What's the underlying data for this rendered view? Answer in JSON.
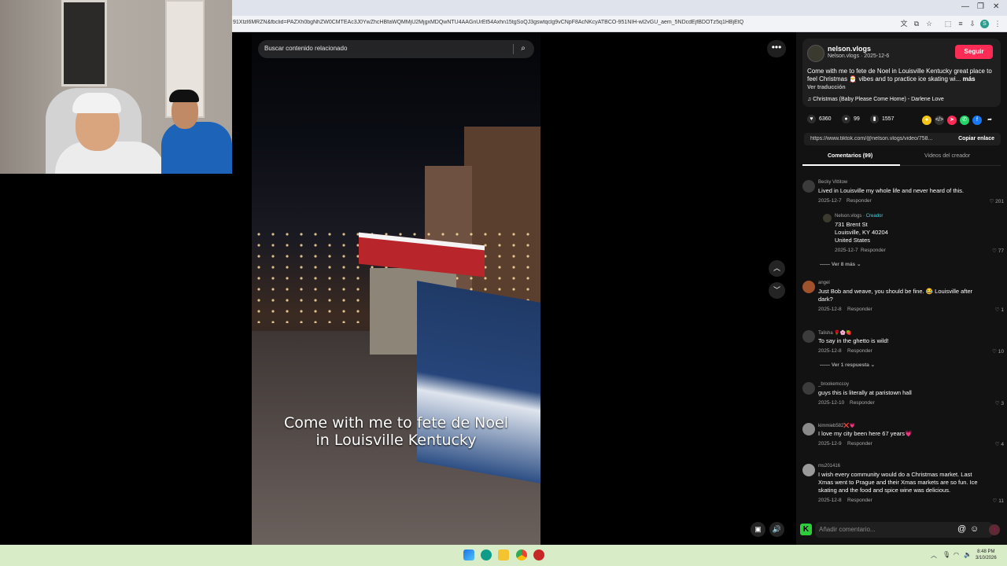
{
  "browser": {
    "url": "91Xtzl6MRZN&fbclid=PAZXh0bgNhZW0CMTEAc3J0YwZhcHBfaWQMMjU2MjgxMDQwNTU4AAGnUrEt54Axhn15tgSoQJ3gswtqclg9vCNpF8AcNKcyATBCO-951NIH-wl2vGU_aem_5NDcdEjfBDOTz5q1HBjEtQ",
    "profile_initial": "S"
  },
  "video": {
    "search_placeholder": "Buscar contenido relacionado",
    "caption_line1": "Come with me to fete de Noel",
    "caption_line2": "in Louisville Kentucky"
  },
  "post": {
    "author_name": "nelson.vlogs",
    "author_meta": "Nelson.vlogs · 2025-12-6",
    "follow_label": "Seguir",
    "description": "Come with me to fete de Noel in Louisville Kentucky great place to feel Christmas 🎅 vibes and to practice ice skating wi...",
    "more_label": "más",
    "translate_label": "Ver traducción",
    "music": "Christmas (Baby Please Come Home) - Darlene Love",
    "likes": "6360",
    "comments": "99",
    "saves": "1557",
    "link": "https://www.tiktok.com/@nelson.vlogs/video/758...",
    "copy_label": "Copiar enlace"
  },
  "tabs": {
    "comments": "Comentarios (99)",
    "creator_videos": "Videos del creador"
  },
  "comments": [
    {
      "user": "Becky Vittitow",
      "text": "Lived in Louisville my whole life and never heard of this.",
      "date": "2025-12-7",
      "reply": "Responder",
      "likes": "201"
    },
    {
      "user": "angel",
      "text": "Just Bob and weave, you should be fine. 😂 Louisville after dark?",
      "date": "2025-12-8",
      "reply": "Responder",
      "likes": "1"
    },
    {
      "user": "Talisha 🌹🌸🍓",
      "text": "To say in the ghetto is wild!",
      "date": "2025-12-8",
      "reply": "Responder",
      "likes": "10"
    },
    {
      "user": "_brookemccoy",
      "text": "guys this is literally at paristown hall",
      "date": "2025-12-10",
      "reply": "Responder",
      "likes": "3"
    },
    {
      "user": "kimmieb582❌💗",
      "text": "I love my city been here 67 years💗",
      "date": "2025-12-9",
      "reply": "Responder",
      "likes": "4"
    },
    {
      "user": "ms201416",
      "text": "I wish every community would do a Christmas market. Last Xmas went to Prague and their Xmas markets are so fun. Ice skating and the food and spice wine was delicious.",
      "date": "2025-12-8",
      "reply": "Responder",
      "likes": "11"
    }
  ],
  "creator_reply": {
    "user": "Nelson.vlogs",
    "badge": "· Creador",
    "line1": "731 Brent St",
    "line2": "Louisville, KY 40204",
    "line3": "United States",
    "date": "2025-12-7",
    "reply": "Responder",
    "likes": "77"
  },
  "see_more": "Ver 8 más",
  "see_reply": "Ver 1 respuesta",
  "comment_input": {
    "placeholder": "Añadir comentario..."
  },
  "taskbar": {
    "time": "8:48 PM",
    "date": "3/10/2026"
  },
  "colors": {
    "accent": "#fe2c55",
    "creator": "#3fd5e3"
  }
}
